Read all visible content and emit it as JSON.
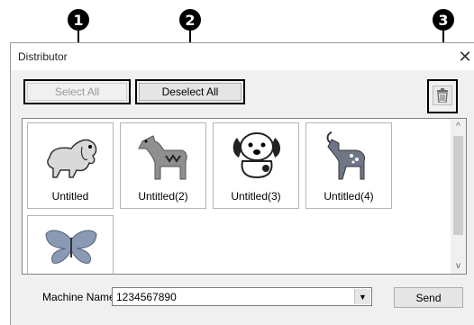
{
  "callouts": [
    "1",
    "2",
    "3"
  ],
  "window": {
    "title": "Distributor",
    "close_glyph": "✕"
  },
  "toolbar": {
    "select_all_label": "Select All",
    "deselect_all_label": "Deselect All",
    "delete_icon": "trash-icon"
  },
  "designs": [
    {
      "label": "Untitled",
      "icon": "dog-spaniel-icon"
    },
    {
      "label": "Untitled(2)",
      "icon": "horse-icon"
    },
    {
      "label": "Untitled(3)",
      "icon": "puppy-icon"
    },
    {
      "label": "Untitled(4)",
      "icon": "goat-icon"
    },
    {
      "label": "",
      "icon": "butterfly-icon"
    }
  ],
  "footer": {
    "machine_name_label": "Machine Name:",
    "machine_name_value": "1234567890",
    "send_label": "Send"
  },
  "scrollbar": {
    "up_glyph": "^",
    "down_glyph": "v"
  }
}
